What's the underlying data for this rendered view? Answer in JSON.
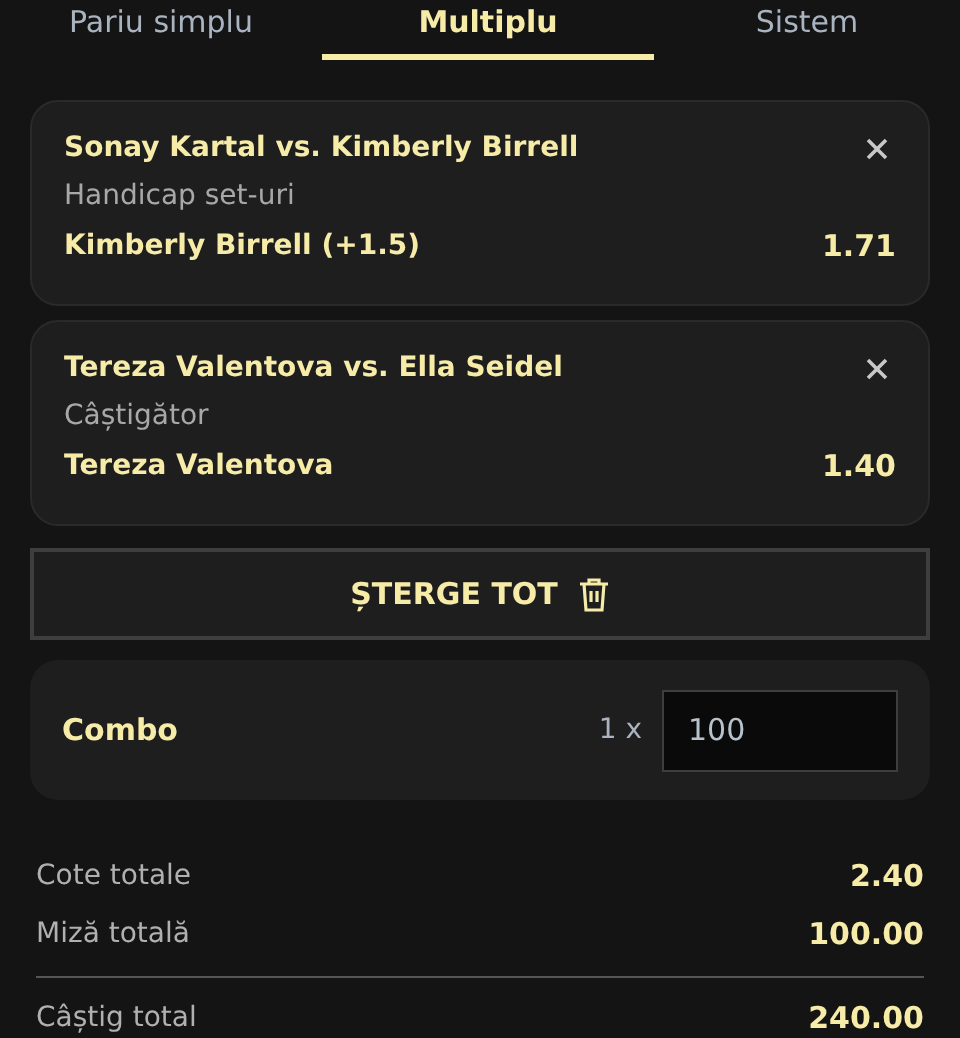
{
  "tabs": [
    {
      "label": "Pariu simplu",
      "selected": false
    },
    {
      "label": "Multiplu",
      "selected": true
    },
    {
      "label": "Sistem",
      "selected": false
    }
  ],
  "bets": [
    {
      "event": "Sonay Kartal vs. Kimberly Birrell",
      "market": "Handicap set-uri",
      "selection": "Kimberly Birrell (+1.5)",
      "odds": "1.71"
    },
    {
      "event": "Tereza Valentova vs. Ella Seidel",
      "market": "Câștigător",
      "selection": "Tereza Valentova",
      "odds": "1.40"
    }
  ],
  "clear_button": {
    "label": "ȘTERGE TOT"
  },
  "combo": {
    "label": "Combo",
    "multiplier": "1 x",
    "stake": "100"
  },
  "totals": [
    {
      "label": "Cote totale",
      "value": "2.40",
      "divider_before": false
    },
    {
      "label": "Miză totală",
      "value": "100.00",
      "divider_before": false
    },
    {
      "label": "Câștig total",
      "value": "240.00",
      "divider_before": true
    }
  ]
}
